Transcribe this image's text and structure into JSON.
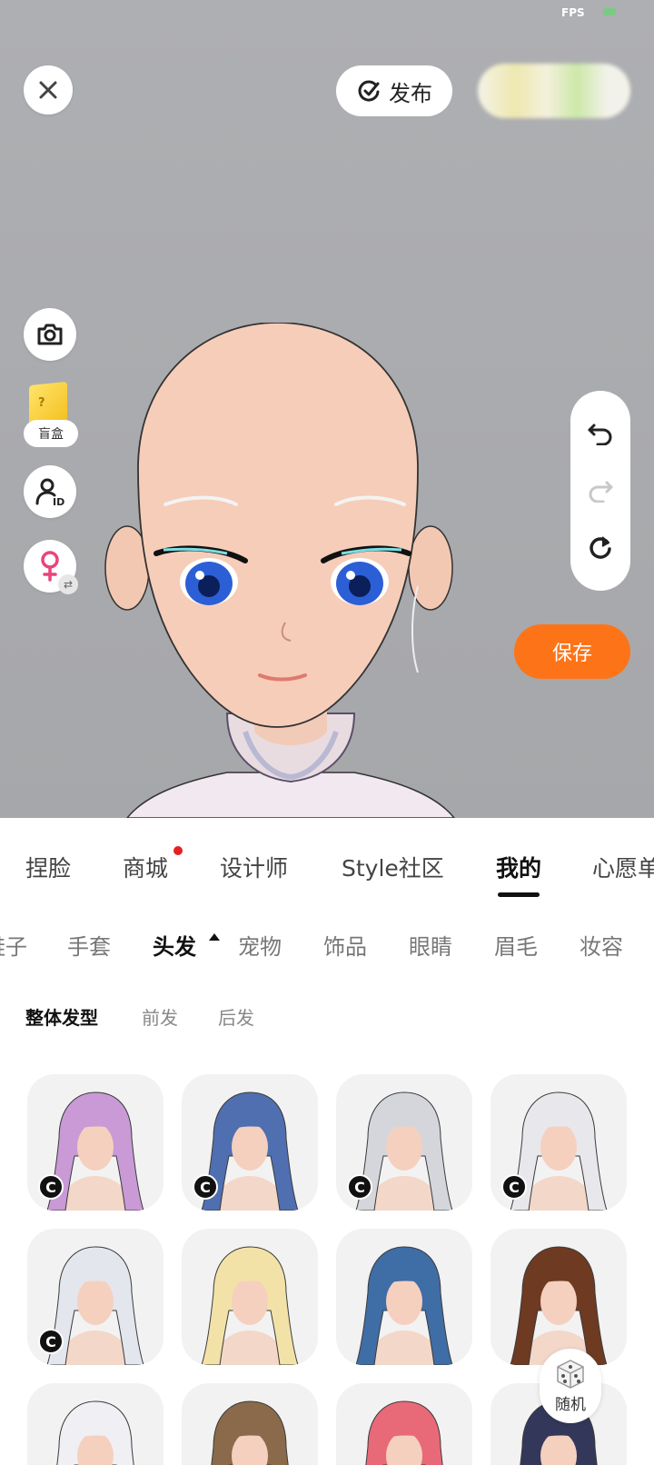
{
  "status": {
    "fps_label": "FPS"
  },
  "top_bar": {
    "publish_label": "发布"
  },
  "side_tools": {
    "blindbox_label": "盲盒"
  },
  "save_label": "保存",
  "random_label": "随机",
  "main_tabs": [
    {
      "label": "捏脸",
      "active": false
    },
    {
      "label": "商城",
      "active": false,
      "badge": true
    },
    {
      "label": "设计师",
      "active": false
    },
    {
      "label": "Style社区",
      "active": false
    },
    {
      "label": "我的",
      "active": true
    },
    {
      "label": "心愿单",
      "active": false
    }
  ],
  "categories": [
    {
      "label": "鞋子",
      "active": false
    },
    {
      "label": "手套",
      "active": false
    },
    {
      "label": "头发",
      "active": true
    },
    {
      "label": "宠物",
      "active": false
    },
    {
      "label": "饰品",
      "active": false
    },
    {
      "label": "眼睛",
      "active": false
    },
    {
      "label": "眉毛",
      "active": false
    },
    {
      "label": "妆容",
      "active": false
    }
  ],
  "subcategories": [
    {
      "label": "整体发型",
      "active": true
    },
    {
      "label": "前发",
      "active": false
    },
    {
      "label": "后发",
      "active": false
    }
  ],
  "hair_items": [
    {
      "name": "purple-wavy-hair",
      "hair_color": "#c99ad6",
      "badge": "C"
    },
    {
      "name": "blue-long-hair-cat-ears",
      "hair_color": "#4f6fb0",
      "badge": "C"
    },
    {
      "name": "silver-braid-hair",
      "hair_color": "#d4d6dc",
      "badge": "C"
    },
    {
      "name": "white-maid-hair",
      "hair_color": "#e8e8ec",
      "badge": "C"
    },
    {
      "name": "white-hair-cat-beanie",
      "hair_color": "#e4e6ee",
      "badge": "C"
    },
    {
      "name": "blonde-bunny-ears-hair",
      "hair_color": "#f3e2a8",
      "badge": ""
    },
    {
      "name": "blue-bob-hair",
      "hair_color": "#3f6da6",
      "badge": ""
    },
    {
      "name": "brown-bob-red-headband",
      "hair_color": "#6e3a22",
      "badge": ""
    },
    {
      "name": "white-hair-pink-horns",
      "hair_color": "#f0f0f4",
      "badge": ""
    },
    {
      "name": "brown-curly-hair",
      "hair_color": "#8a6a4a",
      "badge": ""
    },
    {
      "name": "pink-hair-tiara",
      "hair_color": "#e86a78",
      "badge": ""
    },
    {
      "name": "dark-navy-spiky-hair",
      "hair_color": "#33385a",
      "badge": ""
    }
  ],
  "colors": {
    "accent": "#fd7418",
    "badge_red": "#e52222"
  }
}
